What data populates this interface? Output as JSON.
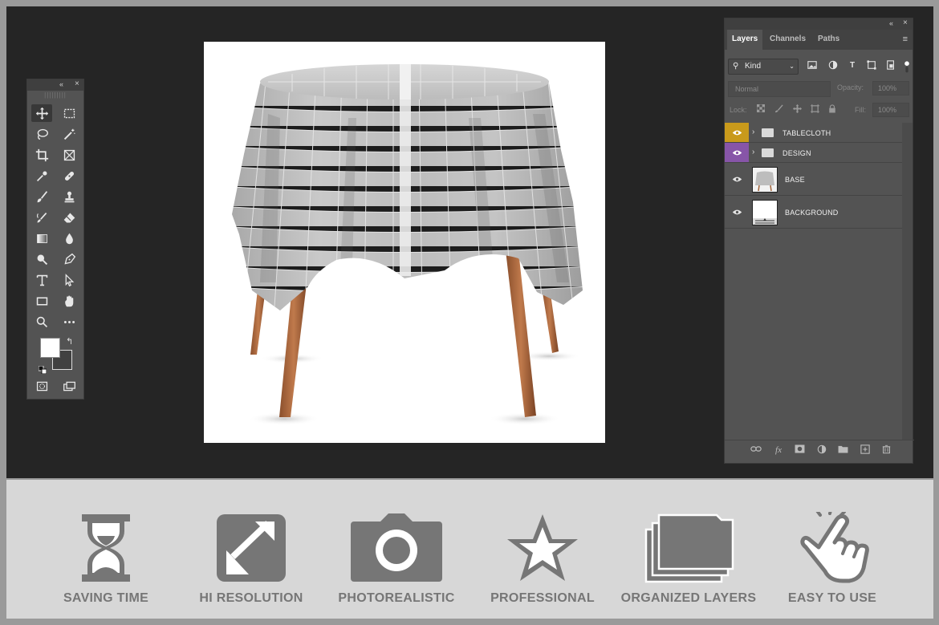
{
  "tools_panel": {
    "collapse_label": "«",
    "close_label": "×",
    "grip": "|||||||||"
  },
  "layers_panel": {
    "collapse_label": "«",
    "close_label": "×",
    "tabs": [
      "Layers",
      "Channels",
      "Paths"
    ],
    "menu_label": "≡",
    "filter_kind": "Kind",
    "blend_mode": "Normal",
    "opacity_label": "Opacity:",
    "opacity_value": "100%",
    "lock_label": "Lock:",
    "fill_label": "Fill:",
    "fill_value": "100%",
    "layers": [
      {
        "name": "TABLECLOTH",
        "eye_color": "#c99a1b",
        "type": "group"
      },
      {
        "name": "DESIGN",
        "eye_color": "#8755a8",
        "type": "group"
      },
      {
        "name": "BASE",
        "type": "pixel"
      },
      {
        "name": "BACKGROUND",
        "type": "pixel"
      }
    ]
  },
  "features": [
    {
      "label": "SAVING TIME",
      "icon": "hourglass-icon"
    },
    {
      "label": "HI RESOLUTION",
      "icon": "expand-arrows-icon"
    },
    {
      "label": "PHOTOREALISTIC",
      "icon": "camera-icon"
    },
    {
      "label": "PROFESSIONAL",
      "icon": "star-icon"
    },
    {
      "label": "ORGANIZED LAYERS",
      "icon": "layers-folder-icon"
    },
    {
      "label": "EASY TO USE",
      "icon": "pointing-hand-icon"
    }
  ],
  "colors": {
    "workspace": "#252525",
    "panel": "#535353",
    "feature_bar": "#d7d7d7",
    "feature_icon": "#767676"
  }
}
